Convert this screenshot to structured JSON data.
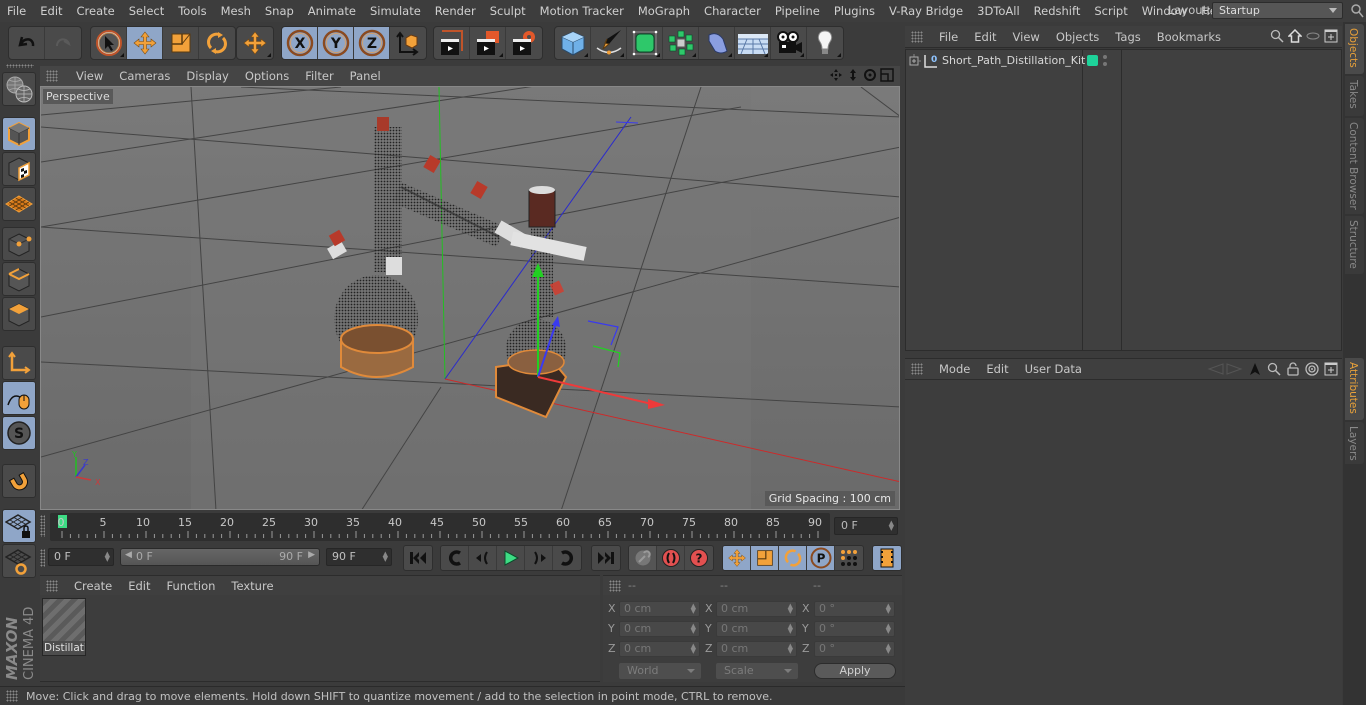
{
  "menubar": {
    "items": [
      "File",
      "Edit",
      "Create",
      "Select",
      "Tools",
      "Mesh",
      "Snap",
      "Animate",
      "Simulate",
      "Render",
      "Sculpt",
      "Motion Tracker",
      "MoGraph",
      "Character",
      "Pipeline",
      "Plugins",
      "V-Ray Bridge",
      "3DToAll",
      "Redshift",
      "Script",
      "Window",
      "Help"
    ],
    "layout_label": "Layout:",
    "layout_value": "Startup"
  },
  "toolbar": {
    "groups": [
      [
        "undo-icon",
        "redo-icon"
      ],
      [
        "live-selection-icon",
        "move-icon",
        "scale-icon",
        "rotate-icon"
      ],
      [
        "recent-tool-icon"
      ],
      [
        "x-axis-lock-icon",
        "y-axis-lock-icon",
        "z-axis-lock-icon",
        "coordinate-system-icon"
      ],
      [
        "render-view-icon",
        "render-picture-viewer-icon",
        "render-settings-icon"
      ],
      [
        "cube-primitive-icon",
        "pen-spline-icon",
        "subdivision-surface-icon",
        "cloner-icon",
        "deformer-icon",
        "floor-scene-icon",
        "camera-icon",
        "light-icon"
      ]
    ],
    "active": [
      "move-icon",
      "x-axis-lock-icon",
      "y-axis-lock-icon",
      "z-axis-lock-icon"
    ]
  },
  "left_tools": [
    "make-editable-icon",
    "model-mode-icon",
    "texture-mode-icon",
    "workplane-mode-icon",
    "points-mode-icon",
    "edges-mode-icon",
    "polygons-mode-icon",
    "axis-mode-icon",
    "tweak-mode-icon",
    "solo-mode-icon",
    "snapping-icon",
    "locked-workplane-icon",
    "planar-workplane-icon"
  ],
  "viewport": {
    "menu": [
      "View",
      "Cameras",
      "Display",
      "Options",
      "Filter",
      "Panel"
    ],
    "camera_label": "Perspective",
    "grid_spacing": "Grid Spacing : 100 cm",
    "axis_labels": {
      "x": "X",
      "y": "Y",
      "z": "Z"
    }
  },
  "timeline": {
    "ticks": [
      "0",
      "5",
      "10",
      "15",
      "20",
      "25",
      "30",
      "35",
      "40",
      "45",
      "50",
      "55",
      "60",
      "65",
      "70",
      "75",
      "80",
      "85",
      "90"
    ],
    "current_frame_field": "0 F",
    "current_frame": 0,
    "start_field": "0 F",
    "range_start": "0 F",
    "range_end": "90 F",
    "end_field": "90 F"
  },
  "transport": {
    "buttons": [
      "goto-start-icon",
      "prev-keyframe-icon",
      "prev-frame-icon",
      "play-icon",
      "next-frame-icon",
      "next-keyframe-icon",
      "goto-end-icon",
      "motion-record-icon",
      "autokey-icon",
      "keyframe-selection-icon",
      "key-move-icon",
      "key-scale-icon",
      "key-rotate-icon",
      "key-param-icon",
      "key-pla-icon",
      "timeline-window-icon"
    ]
  },
  "material_manager": {
    "menu": [
      "Create",
      "Edit",
      "Function",
      "Texture"
    ],
    "materials": [
      {
        "name": "Distillati"
      }
    ]
  },
  "coordinates": {
    "headers": [
      "--",
      "--",
      "--"
    ],
    "rows": [
      {
        "axis": "X",
        "pos": "0 cm",
        "size": "0 cm",
        "rot": "0 °"
      },
      {
        "axis": "Y",
        "pos": "0 cm",
        "size": "0 cm",
        "rot": "0 °"
      },
      {
        "axis": "Z",
        "pos": "0 cm",
        "size": "0 cm",
        "rot": "0 °"
      }
    ],
    "mode_dropdown": "World",
    "size_dropdown": "Scale",
    "apply_label": "Apply"
  },
  "object_manager": {
    "menu": [
      "File",
      "Edit",
      "View",
      "Objects",
      "Tags",
      "Bookmarks"
    ],
    "objects": [
      {
        "name": "Short_Path_Distillation_Kit",
        "color": "#1ed39a"
      }
    ]
  },
  "attribute_manager": {
    "menu": [
      "Mode",
      "Edit",
      "User Data"
    ]
  },
  "right_tabs": {
    "top": [
      {
        "label": "Objects",
        "active": true
      },
      {
        "label": "Takes",
        "active": false
      },
      {
        "label": "Content Browser",
        "active": false
      },
      {
        "label": "Structure",
        "active": false
      }
    ],
    "bottom": [
      {
        "label": "Attributes",
        "active": true
      },
      {
        "label": "Layers",
        "active": false
      }
    ]
  },
  "status": {
    "text": "Move: Click and drag to move elements. Hold down SHIFT to quantize movement / add to the selection in point mode, CTRL to remove."
  },
  "logo": {
    "brand": "MAXON",
    "product": "CINEMA 4D"
  },
  "colors": {
    "accent_blue": "#8fa6c8",
    "accent_orange": "#e8a13a",
    "keyframe_green": "#3ddc84"
  }
}
